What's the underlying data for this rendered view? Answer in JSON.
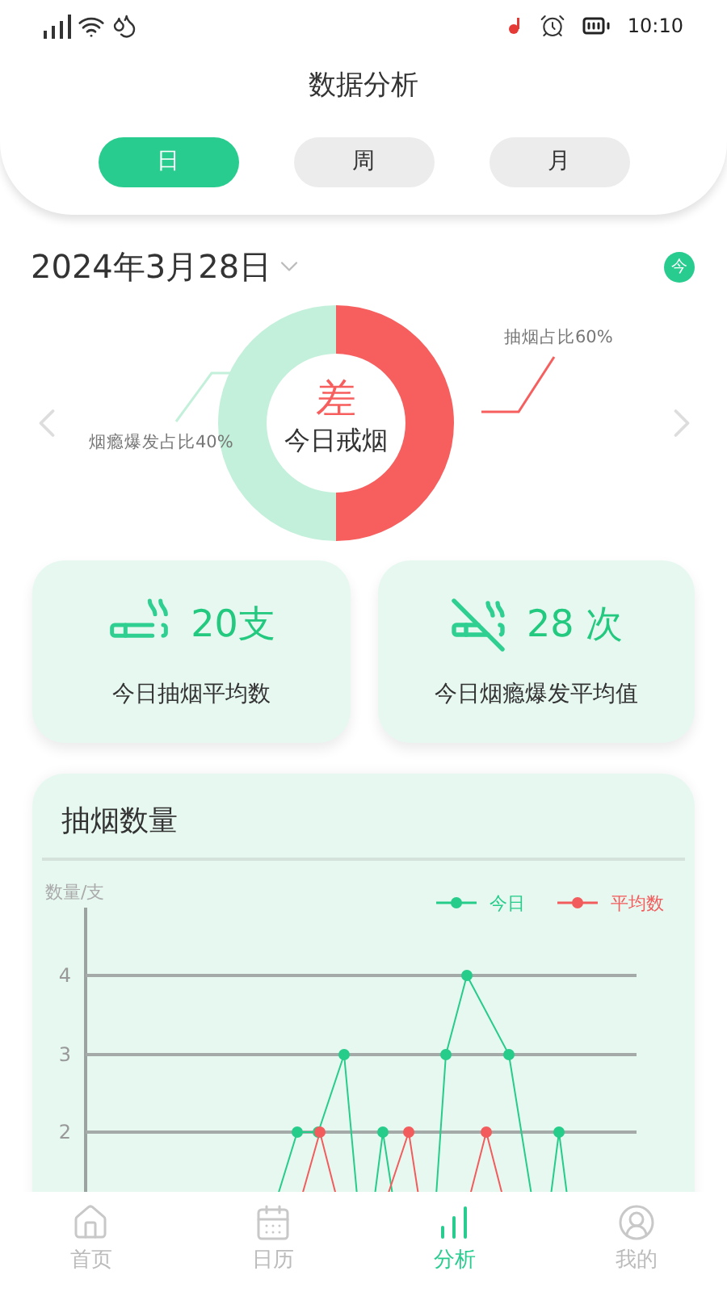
{
  "status_bar": {
    "time": "10:10"
  },
  "title": "数据分析",
  "tabs": [
    {
      "label": "日",
      "selected": true
    },
    {
      "label": "周",
      "selected": false
    },
    {
      "label": "月",
      "selected": false
    }
  ],
  "date": "2024年3月28日",
  "today_badge": "今",
  "ratio": {
    "grade": "差",
    "caption": "今日戒烟",
    "smoking_label": "抽烟占比60%",
    "craving_label": "烟瘾爆发占比40%"
  },
  "stats": [
    {
      "kind": "cigarette",
      "value": "20支",
      "label": "今日抽烟平均数"
    },
    {
      "kind": "no-smoking",
      "value": "28 次",
      "label": "今日烟瘾爆发平均值"
    }
  ],
  "smoking_chart": {
    "title": "抽烟数量",
    "y_unit": "数量/支",
    "y_ticks": [
      "4",
      "3",
      "2"
    ],
    "legend": [
      {
        "label": "今日",
        "color": "#26cc8a"
      },
      {
        "label": "平均数",
        "color": "#f25c5c"
      }
    ]
  },
  "nav": [
    {
      "kind": "home",
      "label": "首页",
      "selected": false
    },
    {
      "kind": "calendar",
      "label": "日历",
      "selected": false
    },
    {
      "kind": "analysis",
      "label": "分析",
      "selected": true
    },
    {
      "kind": "profile",
      "label": "我的",
      "selected": false
    }
  ]
}
